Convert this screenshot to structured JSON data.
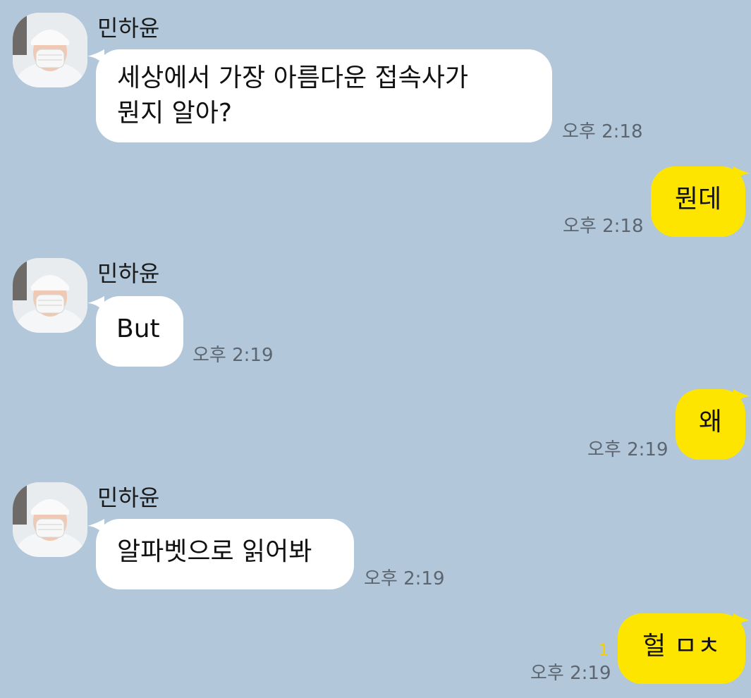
{
  "chat": {
    "sender_name": "민하윤",
    "messages": [
      {
        "direction": "in",
        "lines": [
          "세상에서 가장 아름다운 접속사가",
          "뭔지 알아?"
        ],
        "time": "오후 2:18"
      },
      {
        "direction": "out",
        "text": "뭔데",
        "time": "오후 2:18"
      },
      {
        "direction": "in",
        "text": "But",
        "time": "오후 2:19"
      },
      {
        "direction": "out",
        "text": "왜",
        "time": "오후 2:19"
      },
      {
        "direction": "in",
        "text": "알파벳으로 읽어봐",
        "time": "오후 2:19"
      },
      {
        "direction": "out",
        "text": "헐 ㅁㅊ",
        "time": "오후 2:19",
        "unread": "1"
      }
    ]
  },
  "colors": {
    "background": "#b2c7da",
    "incoming_bubble": "#ffffff",
    "outgoing_bubble": "#fee500",
    "timestamp": "#5d6670",
    "unread_count": "#f5d000"
  },
  "icons": {
    "avatar": "profile-photo-avatar-icon"
  }
}
